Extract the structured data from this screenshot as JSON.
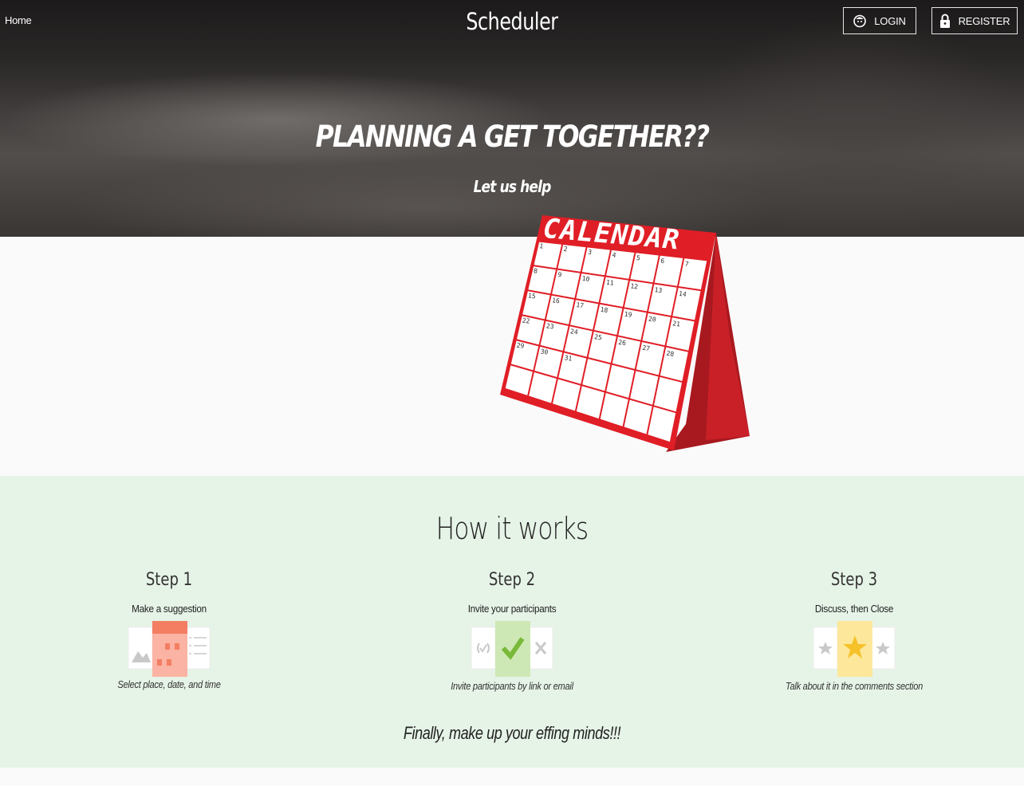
{
  "nav": {
    "home_label": "Home",
    "brand": "Scheduler",
    "login_label": "LOGIN",
    "register_label": "REGISTER"
  },
  "hero": {
    "headline": "PLANNING A GET TOGETHER??",
    "subline": "Let us help",
    "calendar_header": "CALENDAR",
    "calendar_days": [
      "1",
      "2",
      "3",
      "4",
      "5",
      "6",
      "7",
      "8",
      "9",
      "10",
      "11",
      "12",
      "13",
      "14",
      "15",
      "16",
      "17",
      "18",
      "19",
      "20",
      "21",
      "22",
      "23",
      "24",
      "25",
      "26",
      "27",
      "28",
      "29",
      "30",
      "31"
    ]
  },
  "how": {
    "title": "How it works",
    "steps": [
      {
        "title": "Step 1",
        "subtitle": "Make a suggestion",
        "description": "Select place, date, and time"
      },
      {
        "title": "Step 2",
        "subtitle": "Invite your participants",
        "description": "Invite participants by link or email"
      },
      {
        "title": "Step 3",
        "subtitle": "Discuss, then Close",
        "description": "Talk about it in the comments section"
      }
    ],
    "closing": "Finally, make up your effing minds!!!"
  },
  "colors": {
    "calendar_red": "#e01e26",
    "how_bg": "#e6f3e7",
    "step1_accent": "#f9a08a",
    "step2_accent": "#cde8b4",
    "step3_accent": "#fde79b"
  }
}
